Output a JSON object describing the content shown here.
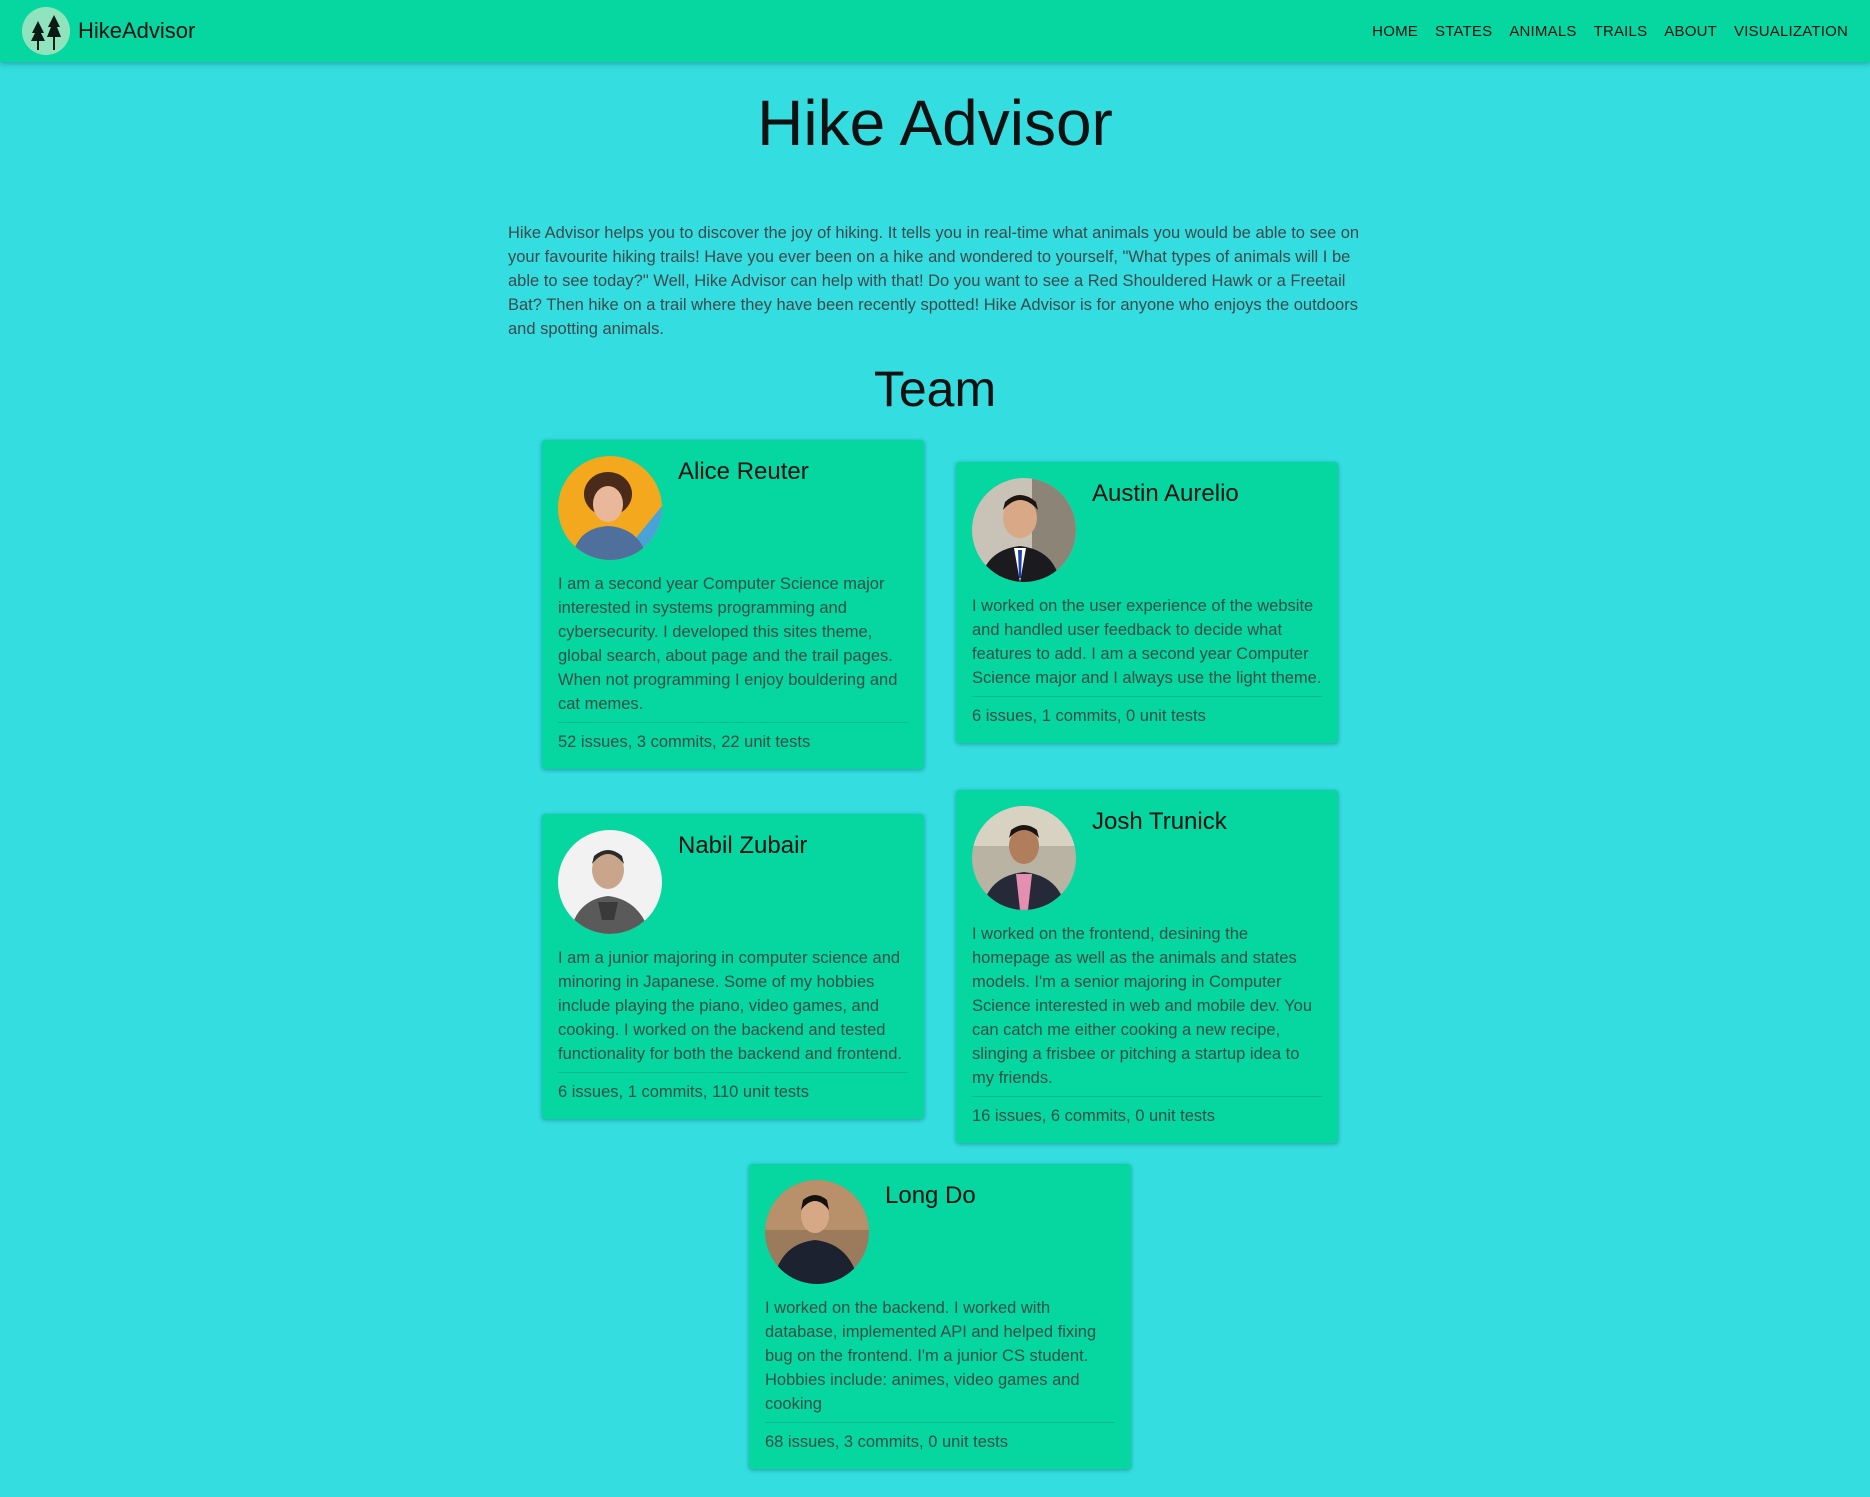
{
  "navbar": {
    "brand": "HikeAdvisor",
    "links": [
      "HOME",
      "STATES",
      "ANIMALS",
      "TRAILS",
      "ABOUT",
      "VISUALIZATION"
    ]
  },
  "page": {
    "title": "Hike Advisor",
    "intro": "Hike Advisor helps you to discover the joy of hiking. It tells you in real-time what animals you would be able to see on your favourite hiking trails! Have you ever been on a hike and wondered to yourself, \"What types of animals will I be able to see today?\" Well, Hike Advisor can help with that! Do you want to see a Red Shouldered Hawk or a Freetail Bat? Then hike on a trail where they have been recently spotted! Hike Advisor is for anyone who enjoys the outdoors and spotting animals.",
    "team_heading": "Team"
  },
  "colors": {
    "page_background": "#33dde0",
    "navbar_background": "#06d6a0",
    "card_background": "#06d6a0"
  },
  "team": [
    {
      "name": "Alice Reuter",
      "bio": "I am a second year Computer Science major interested in systems programming and cybersecurity. I developed this sites theme, global search, about page and the trail pages. When not programming I enjoy bouldering and cat memes.",
      "stats": "52 issues, 3 commits, 22 unit tests"
    },
    {
      "name": "Austin Aurelio",
      "bio": "I worked on the user experience of the website and handled user feedback to decide what features to add. I am a second year Computer Science major and I always use the light theme.",
      "stats": "6 issues, 1 commits, 0 unit tests"
    },
    {
      "name": "Nabil Zubair",
      "bio": "I am a junior majoring in computer science and minoring in Japanese. Some of my hobbies include playing the piano, video games, and cooking. I worked on the backend and tested functionality for both the backend and frontend.",
      "stats": "6 issues, 1 commits, 110 unit tests"
    },
    {
      "name": "Josh Trunick",
      "bio": "I worked on the frontend, desining the homepage as well as the animals and states models. I'm a senior majoring in Computer Science interested in web and mobile dev. You can catch me either cooking a new recipe, slinging a frisbee or pitching a startup idea to my friends.",
      "stats": "16 issues, 6 commits, 0 unit tests"
    },
    {
      "name": "Long Do",
      "bio": "I worked on the backend. I worked with database, implemented API and helped fixing bug on the frontend. I'm a junior CS student. Hobbies include: animes, video games and cooking",
      "stats": "68 issues, 3 commits, 0 unit tests"
    }
  ]
}
